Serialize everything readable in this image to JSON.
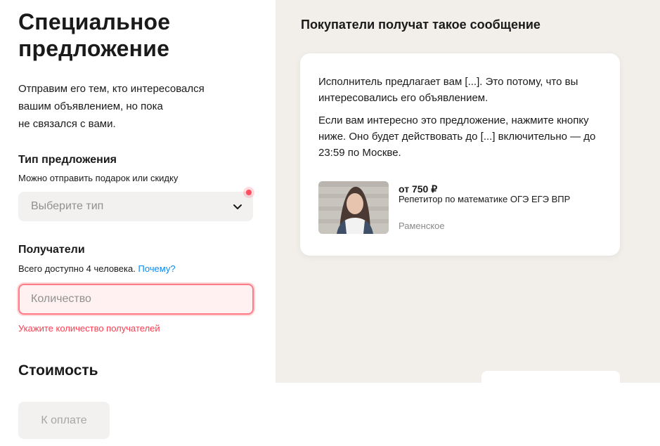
{
  "form": {
    "title": "Специальное предложение",
    "intro_lines": [
      "Отправим его тем, кто интересовался",
      "вашим объявлением, но пока",
      "не связался с вами."
    ],
    "offer_type": {
      "label": "Тип предложения",
      "hint": "Можно отправить подарок или скидку",
      "placeholder": "Выберите тип"
    },
    "recipients": {
      "label": "Получатели",
      "hint": "Всего доступно 4 человека.",
      "why_link": "Почему?",
      "placeholder": "Количество",
      "value": "",
      "error": "Укажите количество получателей"
    },
    "cost": {
      "label": "Стоимость"
    }
  },
  "preview": {
    "title": "Покупатели получат такое сообщение",
    "paragraph1": "Исполнитель предлагает вам [...]. Это потому, что вы интересовались его объявлением.",
    "paragraph2": "Если вам интересно это предложение, нажмите кнопку ниже. Оно будет действовать до [...] включительно — до 23:59 по Москве.",
    "listing": {
      "price": "от 750 ₽",
      "title": "Репетитор по математике ОГЭ ЕГЭ ВПР",
      "location": "Раменское"
    }
  },
  "footer": {
    "pay_button": "К оплате"
  },
  "colors": {
    "accent_link": "#0a8bf5",
    "error": "#ff3b4f",
    "panel_bg": "#f2efea",
    "field_bg": "#f2f1f0"
  }
}
